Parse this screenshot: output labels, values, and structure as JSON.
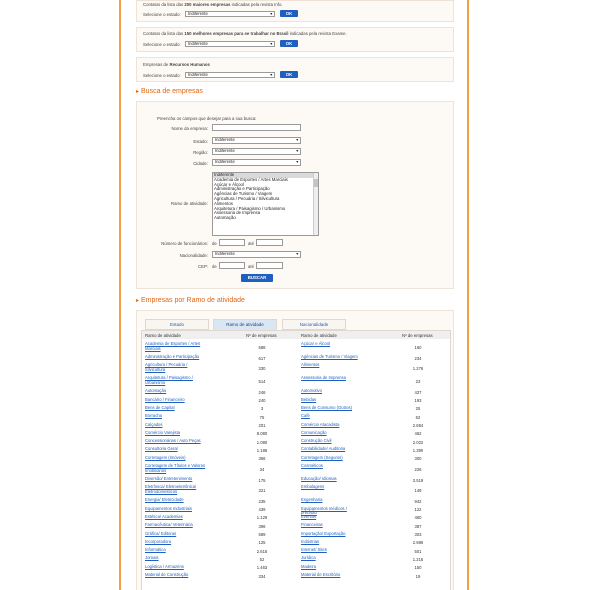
{
  "top_boxes": [
    {
      "desc_prefix": "Contatos da lista das",
      "desc_bold": "200 maiores empresas",
      "desc_suffix": "indicadas pela revista Info.",
      "select_label": "Selecione o estado:",
      "select_value": "Indiferente",
      "button": "OK"
    },
    {
      "desc_prefix": "Contatos da lista das",
      "desc_bold": "150 melhores empresas para se trabalhar no Brasil",
      "desc_suffix": "indicadas pela revista Exame.",
      "select_label": "Selecione o estado:",
      "select_value": "Indiferente",
      "button": "OK"
    },
    {
      "desc_prefix": "Empresas de",
      "desc_bold": "Recursos Humanos",
      "desc_suffix": "",
      "select_label": "Selecione o estado:",
      "select_value": "Indiferente",
      "button": "OK"
    }
  ],
  "busca": {
    "title": "Busca de empresas",
    "intro": "Preencha os campos que desejar para a sua busca:",
    "nome_label": "Nome da empresa:",
    "estado_label": "Estado:",
    "estado_value": "Indiferente",
    "regiao_label": "Região:",
    "regiao_value": "Indiferente",
    "cidade_label": "Cidade:",
    "cidade_value": "Indiferente",
    "ramo_label": "Ramo de atividade:",
    "ramo_options": [
      "Indiferente",
      "Academia de Esportes / Artes Marciais",
      "Açúcar e Álcool",
      "Administração e Participação",
      "Agências de Turismo / Viagem",
      "Agricultura / Pecuária / Silvicultura",
      "Alimentos",
      "Arquitetura / Paisagismo / Urbanismo",
      "Assessoria de Imprensa",
      "Automação"
    ],
    "func_label": "Número de funcionários:",
    "de": "de",
    "ate": "até",
    "nac_label": "Nacionalidade:",
    "nac_value": "Indiferente",
    "cep_label": "CEP:",
    "button": "BUSCAR"
  },
  "ramo": {
    "title": "Empresas por Ramo de atividade",
    "tabs": [
      "Estado",
      "Ramo de atividade",
      "Nacionalidade"
    ],
    "col_ramo": "Ramo de atividade",
    "col_num": "Nº de empresas",
    "left": [
      [
        "Academia de Esportes / Artes Marciais",
        "588"
      ],
      [
        "Administração e Participação",
        "617"
      ],
      [
        "Agricultura / Pecuária / Silvicultura",
        "330"
      ],
      [
        "Arquitetura / Paisagismo / Urbanismo",
        "514"
      ],
      [
        "Automação",
        "246"
      ],
      [
        "Bancário / Financeiro",
        "240"
      ],
      [
        "Bens de Capital",
        "3"
      ],
      [
        "Borracha",
        "75"
      ],
      [
        "Calçados",
        "201"
      ],
      [
        "Comércio Varejista",
        "8.080"
      ],
      [
        "Concessionárias / Auto Peças",
        "1.080"
      ],
      [
        "Consultoria Geral",
        "1.186"
      ],
      [
        "Corretagem (Imóveis)",
        "366"
      ],
      [
        "Corretagem de Títulos e Valores Imobiliários",
        "34"
      ],
      [
        "Diversão/ Entretenimento",
        "175"
      ],
      [
        "Eletrônica/ Eletroeletrônica/ Eletrodomésticos",
        "321"
      ],
      [
        "Energia/ Eletricidade",
        "235"
      ],
      [
        "Equipamentos Industriais",
        "439"
      ],
      [
        "Estética/ Academias",
        "1.129"
      ],
      [
        "Farmacêutica/ Veterinária",
        "396"
      ],
      [
        "Gráfica/ Editoras",
        "589"
      ],
      [
        "Incorporadora",
        "125"
      ],
      [
        "Informática",
        "2.616"
      ],
      [
        "Jornais",
        "52"
      ],
      [
        "Logística / Armazéns",
        "1.463"
      ],
      [
        "Material de Construção",
        "334"
      ]
    ],
    "right": [
      [
        "Açúcar e Álcool",
        "160"
      ],
      [
        "Agências de Turismo / Viagem",
        "234"
      ],
      [
        "Alimentos",
        "1.276"
      ],
      [
        "Assessoria de Imprensa",
        "23"
      ],
      [
        "Automotivo",
        "437"
      ],
      [
        "Bebidas",
        "193"
      ],
      [
        "Bens de Consumo (Outros)",
        "25"
      ],
      [
        "Café",
        "62"
      ],
      [
        "Comércio Atacadista",
        "2.684"
      ],
      [
        "Comunicação",
        "462"
      ],
      [
        "Construção Civil",
        "2.022"
      ],
      [
        "Contabilidade/ Auditoria",
        "1.390"
      ],
      [
        "Corretagem (Seguros)",
        "300"
      ],
      [
        "Cosméticos",
        "226"
      ],
      [
        "Educação/ Idiomas",
        "3.519"
      ],
      [
        "Embalagens",
        "149"
      ],
      [
        "Engenharia",
        "942"
      ],
      [
        "Equipamentos médicos / precisão",
        "122"
      ],
      [
        "Eventos",
        "460"
      ],
      [
        "Financeiras",
        "387"
      ],
      [
        "Importação/ Exportação",
        "303"
      ],
      [
        "Indústrias",
        "2.986"
      ],
      [
        "Internet/ Sites",
        "501"
      ],
      [
        "Jurídica",
        "1.216"
      ],
      [
        "Madeira",
        "150"
      ],
      [
        "Material de Escritório",
        "19"
      ]
    ]
  }
}
